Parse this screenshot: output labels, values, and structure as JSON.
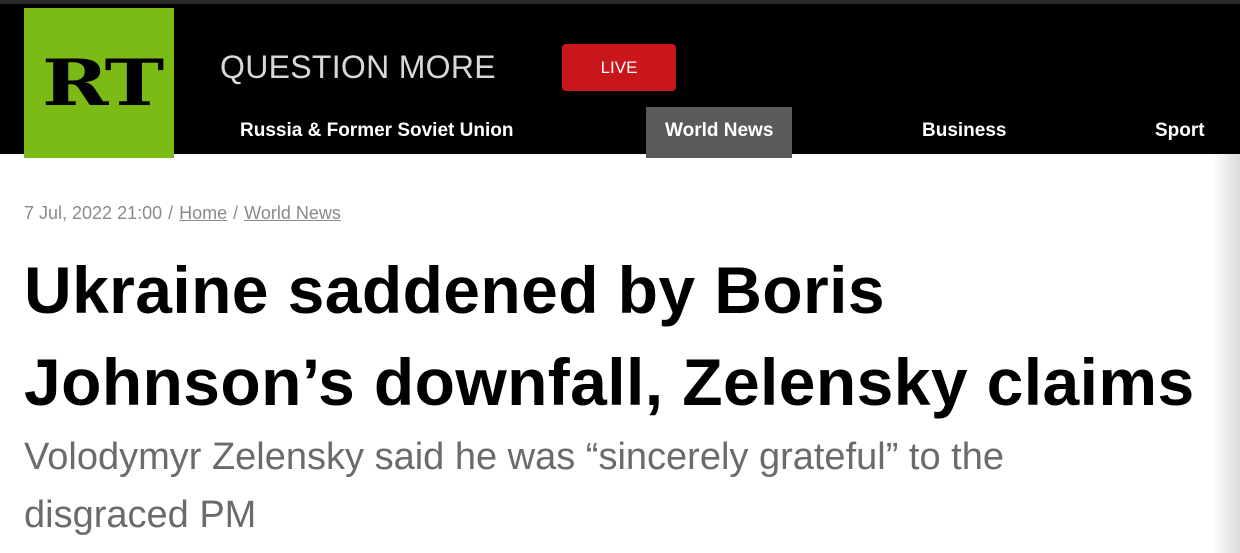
{
  "header": {
    "logo_text": "RT",
    "slogan": "QUESTION MORE",
    "live_label": "LIVE",
    "nav": [
      {
        "label": "Russia & Former Soviet Union",
        "active": false
      },
      {
        "label": "World News",
        "active": true
      },
      {
        "label": "Business",
        "active": false
      },
      {
        "label": "Sport",
        "active": false
      }
    ]
  },
  "article": {
    "date": "7 Jul, 2022 21:00",
    "breadcrumb": [
      "Home",
      "World News"
    ],
    "separator": "/",
    "headline_lines": [
      "Ukraine saddened by Boris",
      "Johnson’s downfall, Zelensky claims"
    ],
    "summary_lines": [
      "Volodymyr Zelensky said he was “sincerely grateful” to the",
      "disgraced PM"
    ]
  },
  "colors": {
    "brand_green": "#7cba15",
    "live_red": "#c9161b",
    "header_bg": "#000000",
    "active_tab_bg": "#5a5a5a",
    "meta_text": "#8a8a8a",
    "summary_text": "#6b6b6b"
  }
}
